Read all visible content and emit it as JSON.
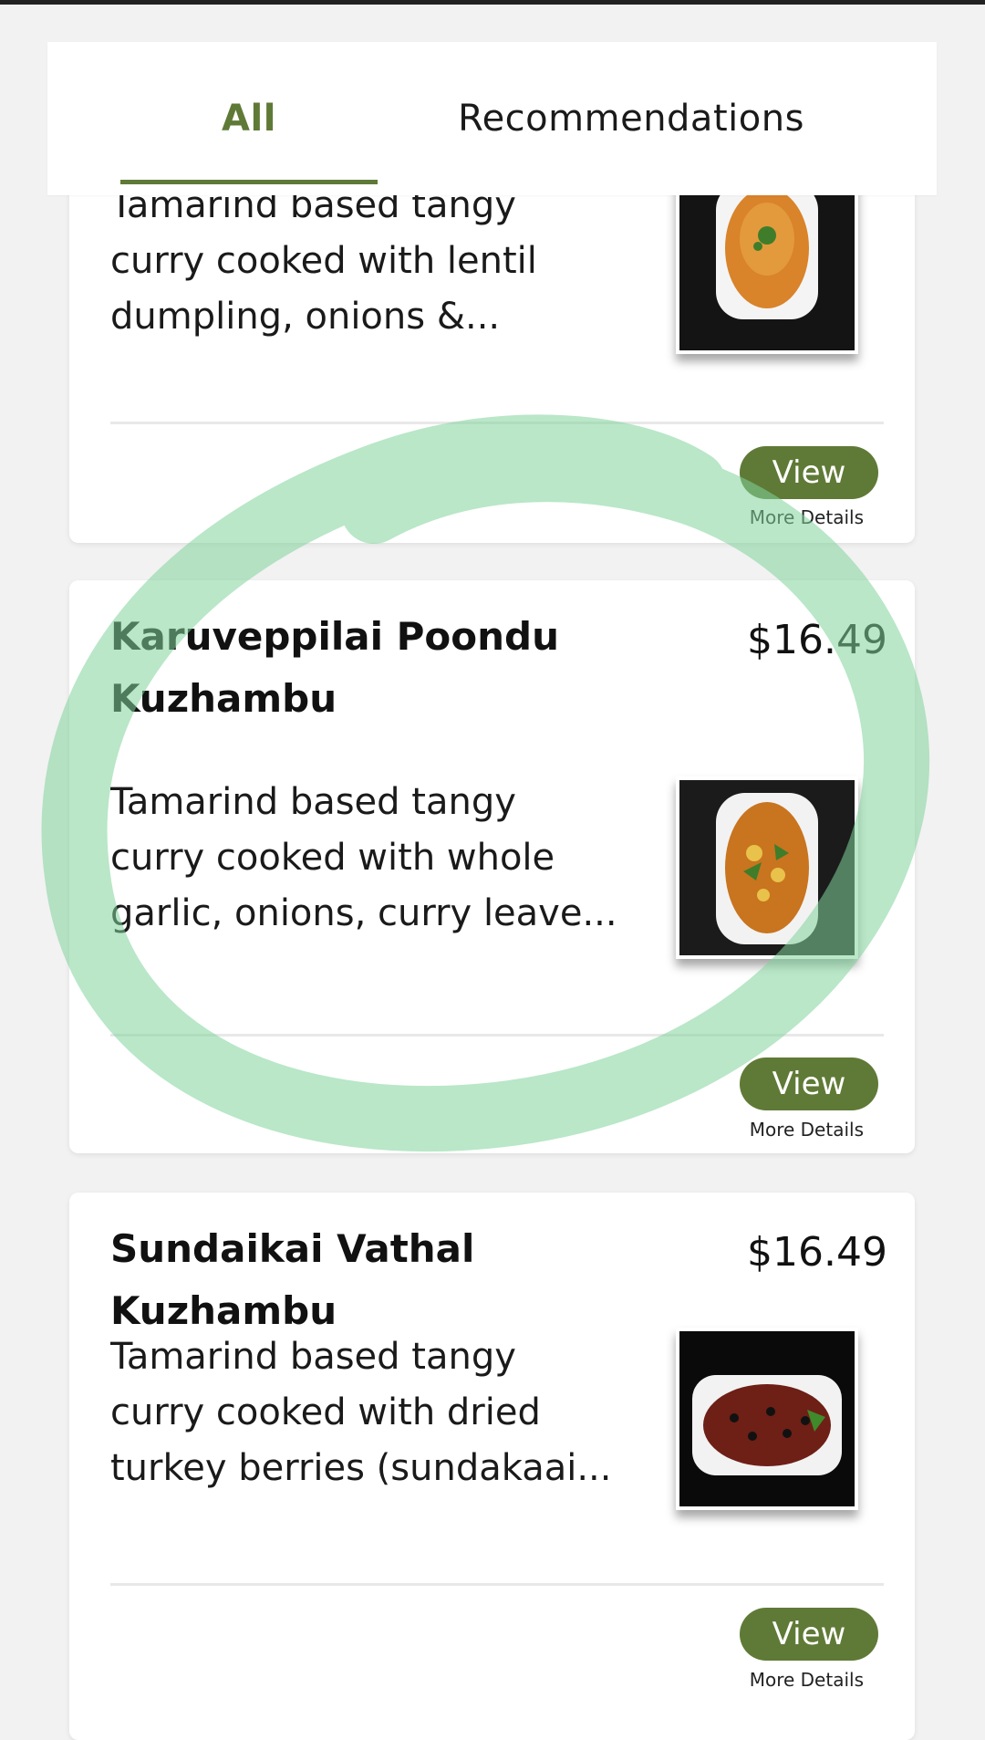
{
  "tabs": [
    {
      "label": "All",
      "active": true
    },
    {
      "label": "Recommendations",
      "active": false
    }
  ],
  "colors": {
    "accent": "#5f7a36",
    "annotation_circle": "#7fd49a"
  },
  "items": [
    {
      "name": "",
      "price": "",
      "description_top_clipped": "Tamarind based tangy",
      "description": "curry cooked with lentil dumpling, onions &...",
      "image_icon": "curry-dish-image",
      "view_label": "View",
      "more_label": "More Details"
    },
    {
      "name": "Karuveppilai Poondu Kuzhambu",
      "price": "$16.49",
      "description": "Tamarind based tangy curry cooked with whole garlic, onions, curry leave...",
      "image_icon": "curry-dish-image",
      "view_label": "View",
      "more_label": "More Details"
    },
    {
      "name": "Sundaikai Vathal Kuzhambu",
      "price": "$16.49",
      "description": "Tamarind based tangy curry cooked with dried turkey berries (sundakaai...",
      "image_icon": "curry-dish-image",
      "view_label": "View",
      "more_label": "More Details"
    }
  ]
}
